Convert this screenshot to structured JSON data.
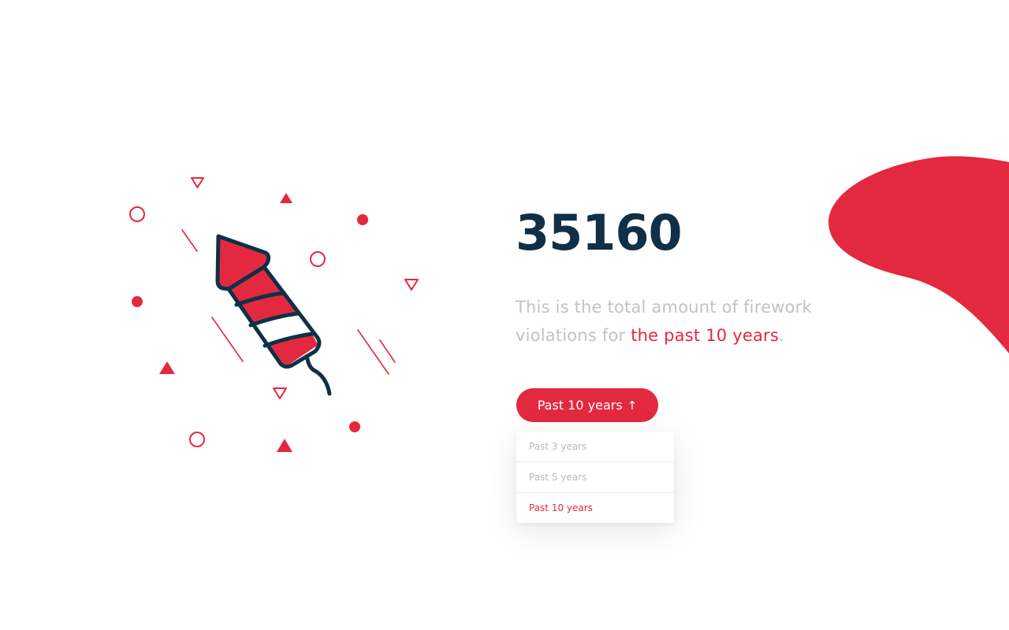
{
  "stats": {
    "count": "35160",
    "description_prefix": "This is the total amount of firework violations for ",
    "description_highlight": "the past 10 years",
    "description_suffix": "."
  },
  "period_button": {
    "label": "Past 10 years",
    "arrow": "↑"
  },
  "dropdown": {
    "options": [
      "Past 3 years",
      "Past 5 years",
      "Past 10 years"
    ],
    "selected_index": 2
  },
  "colors": {
    "accent": "#e3293f",
    "heading": "#0f3046",
    "muted_text": "#c2c2c2",
    "menu_text": "#b9b9b9",
    "background": "#ffffff"
  },
  "icons": {
    "illustration": "firework-rocket-icon",
    "decorations": [
      "triangle-icon",
      "circle-icon",
      "dot-icon",
      "streak-line"
    ],
    "button_arrow": "arrow-up-icon"
  }
}
